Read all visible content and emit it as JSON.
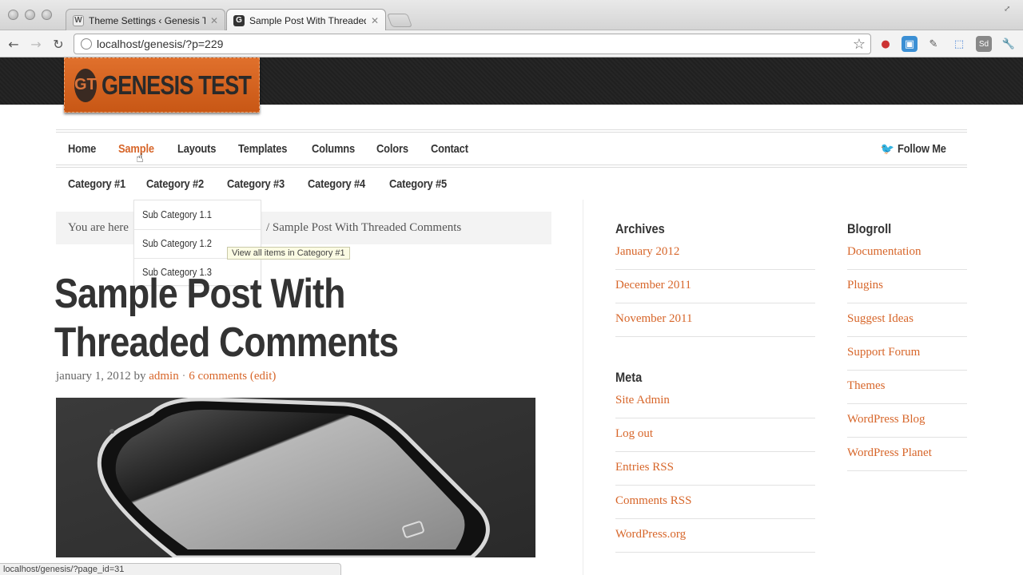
{
  "browser": {
    "tabs": [
      {
        "title": "Theme Settings ‹ Genesis Te",
        "close": "✕"
      },
      {
        "title": "Sample Post With Threaded C",
        "close": "✕"
      }
    ],
    "url": "localhost/genesis/?p=229",
    "status_url": "localhost/genesis/?page_id=31"
  },
  "site": {
    "logo_mark": "GT",
    "logo_text": "GENESIS TEST",
    "accent_color": "#d7662a"
  },
  "nav_primary": [
    {
      "label": "Home"
    },
    {
      "label": "Sample",
      "active": true
    },
    {
      "label": "Layouts"
    },
    {
      "label": "Templates"
    },
    {
      "label": "Columns"
    },
    {
      "label": "Colors"
    },
    {
      "label": "Contact"
    }
  ],
  "follow_label": "Follow Me",
  "nav_secondary": [
    {
      "label": "Category #1"
    },
    {
      "label": "Category #2"
    },
    {
      "label": "Category #3"
    },
    {
      "label": "Category #4"
    },
    {
      "label": "Category #5"
    }
  ],
  "dropdown": [
    {
      "label": "Sub Category 1.1"
    },
    {
      "label": "Sub Category 1.2"
    },
    {
      "label": "Sub Category 1.3"
    }
  ],
  "tooltip": "View all items in Category #1",
  "breadcrumb": {
    "prefix": "You are here",
    "current": "/ Sample Post With Threaded Comments"
  },
  "post": {
    "title": "Sample Post With Threaded Comments",
    "date": "january 1, 2012",
    "by": "by",
    "author": "admin",
    "sep": "·",
    "comments": "6 comments",
    "edit": "(edit)"
  },
  "archives": {
    "title": "Archives",
    "items": [
      "January 2012",
      "December 2011",
      "November 2011"
    ]
  },
  "meta": {
    "title": "Meta",
    "items": [
      "Site Admin",
      "Log out",
      "Entries RSS",
      "Comments RSS",
      "WordPress.org"
    ]
  },
  "blogroll": {
    "title": "Blogroll",
    "items": [
      "Documentation",
      "Plugins",
      "Suggest Ideas",
      "Support Forum",
      "Themes",
      "WordPress Blog",
      "WordPress Planet"
    ]
  }
}
